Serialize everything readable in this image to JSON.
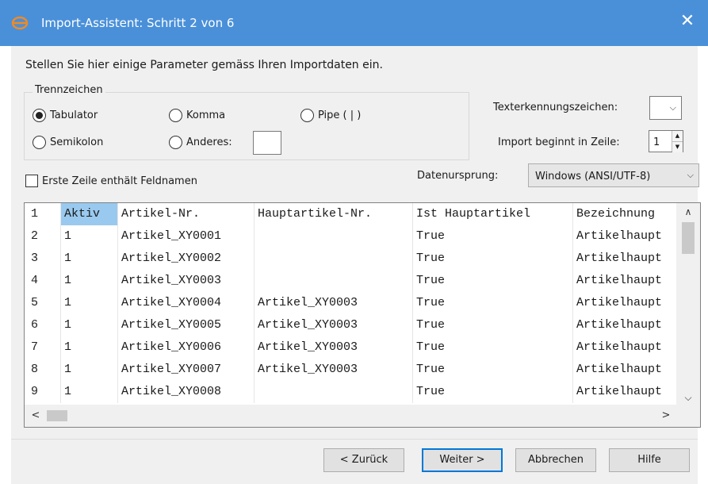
{
  "window": {
    "title": "Import-Assistent:  Schritt 2 von 6",
    "close_glyph": "✕",
    "title_bar_color": "#4a90d9",
    "app_icon": "e-logo-icon"
  },
  "instruction": "Stellen Sie hier einige Parameter gemäss Ihren Importdaten ein.",
  "separator_group": {
    "title": "Trennzeichen",
    "options": [
      {
        "label": "Tabulator",
        "checked": true
      },
      {
        "label": "Komma",
        "checked": false
      },
      {
        "label": "Pipe ( | )",
        "checked": false
      },
      {
        "label": "Semikolon",
        "checked": false
      },
      {
        "label": "Anderes:",
        "checked": false
      }
    ],
    "other_value": ""
  },
  "text_qualifier": {
    "label": "Texterkennungszeichen:",
    "value": "",
    "arrow": "⌵"
  },
  "start_row": {
    "label": "Import beginnt in Zeile:",
    "value": "1"
  },
  "first_row_header": {
    "label": "Erste Zeile enthält Feldnamen",
    "checked": false
  },
  "data_origin": {
    "label": "Datenursprung:",
    "value": "Windows (ANSI/UTF-8)",
    "arrow": "⌵"
  },
  "grid": {
    "rows": [
      {
        "n": "1",
        "cells": [
          "Aktiv",
          "Artikel-Nr.",
          "Hauptartikel-Nr.",
          "Ist Hauptartikel",
          "Bezeichnung"
        ]
      },
      {
        "n": "2",
        "cells": [
          "1",
          "Artikel_XY0001",
          "",
          "True",
          "Artikelhaupt"
        ]
      },
      {
        "n": "3",
        "cells": [
          "1",
          "Artikel_XY0002",
          "",
          "True",
          "Artikelhaupt"
        ]
      },
      {
        "n": "4",
        "cells": [
          "1",
          "Artikel_XY0003",
          "",
          "True",
          "Artikelhaupt"
        ]
      },
      {
        "n": "5",
        "cells": [
          "1",
          "Artikel_XY0004",
          "Artikel_XY0003",
          "True",
          "Artikelhaupt"
        ]
      },
      {
        "n": "6",
        "cells": [
          "1",
          "Artikel_XY0005",
          "Artikel_XY0003",
          "True",
          "Artikelhaupt"
        ]
      },
      {
        "n": "7",
        "cells": [
          "1",
          "Artikel_XY0006",
          "Artikel_XY0003",
          "True",
          "Artikelhaupt"
        ]
      },
      {
        "n": "8",
        "cells": [
          "1",
          "Artikel_XY0007",
          "Artikel_XY0003",
          "True",
          "Artikelhaupt"
        ]
      },
      {
        "n": "9",
        "cells": [
          "1",
          "Artikel_XY0008",
          "",
          "True",
          "Artikelhaupt"
        ]
      }
    ],
    "scroll_up": "∧",
    "scroll_down": "⌵",
    "scroll_left": "<",
    "scroll_right": ">"
  },
  "buttons": {
    "back": "< Zurück",
    "next": "Weiter >",
    "cancel": "Abbrechen",
    "help": "Hilfe"
  }
}
